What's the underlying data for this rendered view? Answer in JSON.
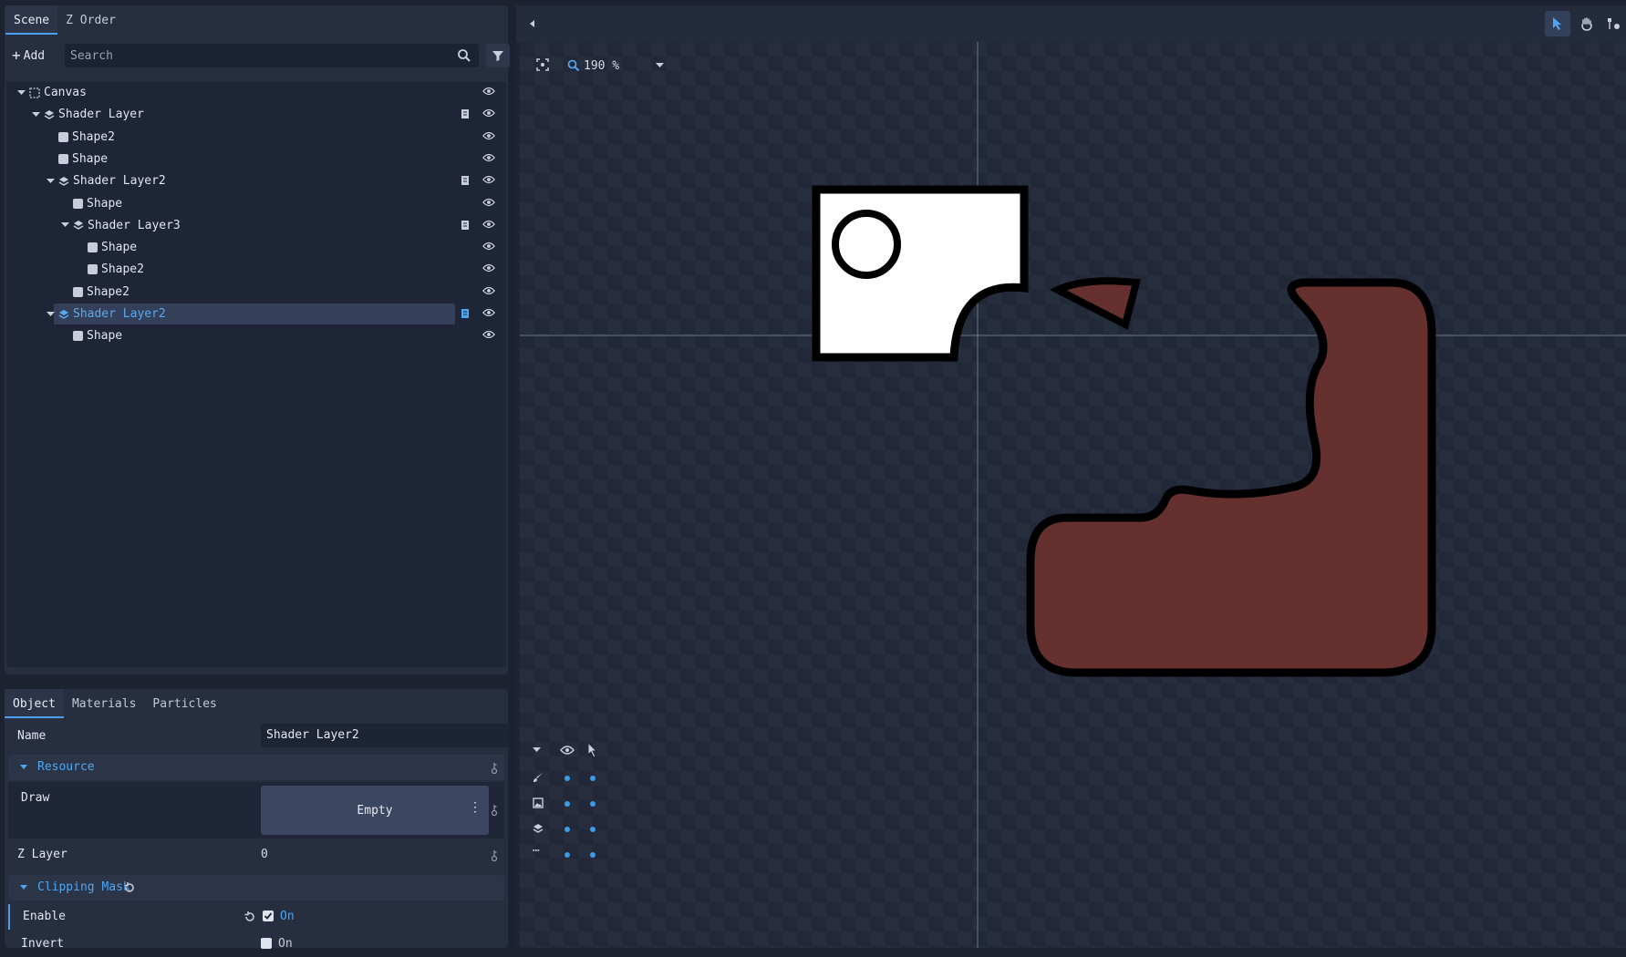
{
  "scene_panel": {
    "tabs": [
      "Scene",
      "Z Order"
    ],
    "add_label": "Add",
    "search_placeholder": "Search",
    "tree": [
      {
        "label": "Canvas",
        "icon": "canvas-icon",
        "depth": 0,
        "expanded": true,
        "script": false
      },
      {
        "label": "Shader Layer",
        "icon": "layers-icon",
        "depth": 1,
        "expanded": true,
        "script": true
      },
      {
        "label": "Shape2",
        "icon": "shape-icon",
        "depth": 2,
        "script": false
      },
      {
        "label": "Shape",
        "icon": "shape-icon",
        "depth": 2,
        "script": false
      },
      {
        "label": "Shader Layer2",
        "icon": "layers-icon",
        "depth": 2,
        "expanded": true,
        "script": true
      },
      {
        "label": "Shape",
        "icon": "shape-icon",
        "depth": 3,
        "script": false
      },
      {
        "label": "Shader Layer3",
        "icon": "layers-icon",
        "depth": 3,
        "expanded": true,
        "script": true
      },
      {
        "label": "Shape",
        "icon": "shape-icon",
        "depth": 4,
        "script": false
      },
      {
        "label": "Shape2",
        "icon": "shape-icon",
        "depth": 4,
        "script": false
      },
      {
        "label": "Shape2",
        "icon": "shape-icon",
        "depth": 3,
        "script": false
      },
      {
        "label": "Shader Layer2",
        "icon": "layers-icon",
        "depth": 2,
        "expanded": true,
        "script": true,
        "selected": true
      },
      {
        "label": "Shape",
        "icon": "shape-icon",
        "depth": 3,
        "script": false
      }
    ]
  },
  "inspector": {
    "tabs": [
      "Object",
      "Materials",
      "Particles"
    ],
    "name_label": "Name",
    "name_value": "Shader Layer2",
    "resource_section": "Resource",
    "draw_label": "Draw",
    "draw_value": "Empty",
    "zlayer_label": "Z Layer",
    "zlayer_value": "0",
    "clipping_section": "Clipping Mask",
    "enable_label": "Enable",
    "enable_value": "On",
    "enable_checked": true,
    "invert_label": "Invert",
    "invert_value": "On",
    "invert_checked": false
  },
  "viewport": {
    "zoom_value": "190 %",
    "accent": "#4a9eea",
    "shape_fill": "#66302f",
    "shape_stroke": "#000000"
  }
}
